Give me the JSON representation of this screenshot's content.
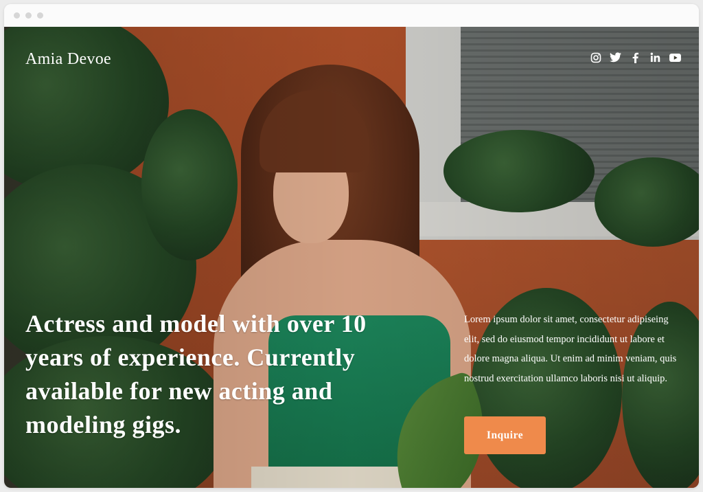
{
  "site": {
    "brand": "Amia Devoe"
  },
  "social": [
    {
      "icon": "instagram-icon",
      "glyph": "◎"
    },
    {
      "icon": "twitter-icon",
      "glyph": "🐦"
    },
    {
      "icon": "facebook-icon",
      "glyph": "f"
    },
    {
      "icon": "linkedin-icon",
      "glyph": "in"
    },
    {
      "icon": "youtube-icon",
      "glyph": "▶"
    }
  ],
  "hero": {
    "headline": "Actress and model with over 10 years of experience. Currently available for new acting and modeling gigs.",
    "blurb": "Lorem ipsum dolor sit amet, consectetur adipiseing elit, sed do eiusmod tempor incididunt ut labore et dolore magna aliqua. Ut enim ad minim veniam, quis nostrud exercitation ullamco laboris nisi ut aliquip.",
    "cta_label": "Inquire"
  },
  "colors": {
    "accent": "#ef8a4b",
    "text": "#ffffff"
  }
}
